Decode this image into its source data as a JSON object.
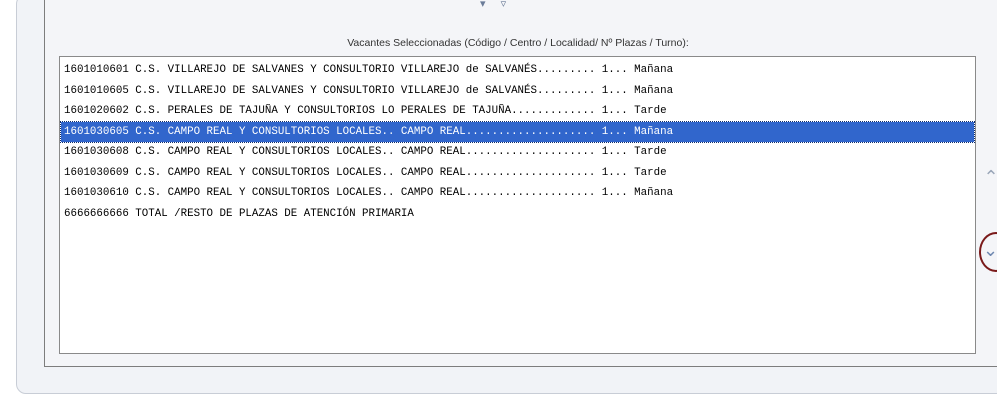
{
  "list_caption": "Vacantes Seleccionadas (Código / Centro / Localidad/ Nº Plazas / Turno):",
  "top_arrows": "▾ ▿",
  "vacancies": [
    "1601010601 C.S. VILLAREJO DE SALVANES Y CONSULTORIO VILLAREJO de SALVANÉS......... 1... Mañana",
    "1601010605 C.S. VILLAREJO DE SALVANES Y CONSULTORIO VILLAREJO de SALVANÉS......... 1... Mañana",
    "1601020602 C.S. PERALES DE TAJUÑA Y CONSULTORIOS LO PERALES DE TAJUÑA............. 1... Tarde",
    "1601030605 C.S. CAMPO REAL Y CONSULTORIOS LOCALES.. CAMPO REAL.................... 1... Mañana",
    "1601030608 C.S. CAMPO REAL Y CONSULTORIOS LOCALES.. CAMPO REAL.................... 1... Tarde",
    "1601030609 C.S. CAMPO REAL Y CONSULTORIOS LOCALES.. CAMPO REAL.................... 1... Tarde",
    "1601030610 C.S. CAMPO REAL Y CONSULTORIOS LOCALES.. CAMPO REAL.................... 1... Mañana",
    "6666666666 TOTAL /RESTO DE PLAZAS DE ATENCIÓN PRIMARIA"
  ],
  "selected_index": 3,
  "move_up_icon": "⌃",
  "move_down_icon": "⌄",
  "colors": {
    "selection": "#3166cc",
    "highlight_circle": "#7a1a1a",
    "arrow": "#6f88b0"
  }
}
